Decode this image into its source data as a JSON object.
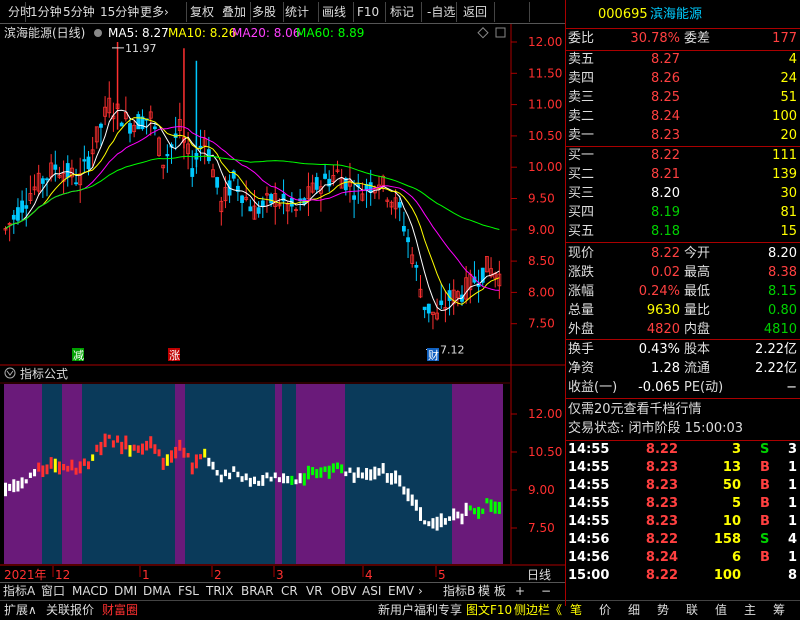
{
  "toolbar": {
    "items": [
      "分时",
      "1分钟",
      "5分钟",
      "15分钟",
      "更多›",
      "复权",
      "叠加",
      "多股",
      "统计",
      "画线",
      "F10",
      "标记",
      "-自选",
      "返回"
    ]
  },
  "chart": {
    "title": "滨海能源(日线)",
    "ma5": "MA5: 8.27",
    "ma10": "MA10: 8.26",
    "ma20": "MA20: 8.06",
    "ma60": "MA60: 8.89",
    "high_label": "11.97",
    "low_label": "7.12",
    "yticks": [
      "12.00",
      "11.50",
      "11.00",
      "10.50",
      "10.00",
      "9.50",
      "9.00",
      "8.50",
      "8.00",
      "7.50"
    ],
    "markers": {
      "jian": "减",
      "zhang": "涨",
      "cai": "财"
    },
    "colors": {
      "up": "#ff3030",
      "down": "#00c8ff",
      "ma5": "#ffffff",
      "ma10": "#ffff00",
      "ma20": "#ff00ff",
      "ma60": "#00ff00"
    }
  },
  "indicator": {
    "title": "指标公式",
    "yticks": [
      "12.00",
      "10.50",
      "9.00",
      "7.50"
    ],
    "colors": {
      "purple": "#6a1a7a",
      "blue": "#0a3a5a"
    }
  },
  "xaxis": {
    "year": "2021年",
    "labels": [
      "12",
      "1",
      "2",
      "3",
      "4",
      "5"
    ],
    "right_label": "日线"
  },
  "tabs": [
    "指标A",
    "窗口",
    "MACD",
    "DMI",
    "DMA",
    "FSL",
    "TRIX",
    "BRAR",
    "CR",
    "VR",
    "OBV",
    "ASI",
    "EMV",
    "›",
    "指标B",
    "模 板",
    "+",
    "−"
  ],
  "statusbar": {
    "left": [
      "扩展∧",
      "关联报价",
      "财富圈"
    ],
    "news": "新用户福利专享",
    "f10": "图文F10",
    "side": "侧边栏《",
    "icons": [
      "笔",
      "价",
      "细",
      "势",
      "联",
      "值",
      "主",
      "筹"
    ]
  },
  "quote": {
    "code": "000695",
    "name": "滨海能源",
    "weibi_label": "委比",
    "weibi": "30.78%",
    "weicha_label": "委差",
    "weicha": "177",
    "asks": [
      {
        "label": "卖五",
        "price": "8.27",
        "vol": "4"
      },
      {
        "label": "卖四",
        "price": "8.26",
        "vol": "24"
      },
      {
        "label": "卖三",
        "price": "8.25",
        "vol": "51"
      },
      {
        "label": "卖二",
        "price": "8.24",
        "vol": "100"
      },
      {
        "label": "卖一",
        "price": "8.23",
        "vol": "20"
      }
    ],
    "bids": [
      {
        "label": "买一",
        "price": "8.22",
        "vol": "111"
      },
      {
        "label": "买二",
        "price": "8.21",
        "vol": "139"
      },
      {
        "label": "买三",
        "price": "8.20",
        "vol": "30"
      },
      {
        "label": "买四",
        "price": "8.19",
        "vol": "81"
      },
      {
        "label": "买五",
        "price": "8.18",
        "vol": "15"
      }
    ],
    "stats": [
      {
        "l1": "现价",
        "v1": "8.22",
        "l2": "今开",
        "v2": "8.20"
      },
      {
        "l1": "涨跌",
        "v1": "0.02",
        "l2": "最高",
        "v2": "8.38"
      },
      {
        "l1": "涨幅",
        "v1": "0.24%",
        "l2": "最低",
        "v2": "8.15"
      },
      {
        "l1": "总量",
        "v1": "9630",
        "l2": "量比",
        "v2": "0.80"
      },
      {
        "l1": "外盘",
        "v1": "4820",
        "l2": "内盘",
        "v2": "4810"
      }
    ],
    "stats2": [
      {
        "l1": "换手",
        "v1": "0.43%",
        "l2": "股本",
        "v2": "2.22亿"
      },
      {
        "l1": "净资",
        "v1": "1.28",
        "l2": "流通",
        "v2": "2.22亿"
      },
      {
        "l1": "收益(一)",
        "v1": "-0.065",
        "l2": "PE(动)",
        "v2": "−"
      }
    ],
    "promo": "仅需20元查看千档行情",
    "trade_status": "交易状态: 闭市阶段 15:00:03",
    "ticks": [
      {
        "t": "14:55",
        "p": "8.22",
        "v": "3",
        "s": "S",
        "n": "3"
      },
      {
        "t": "14:55",
        "p": "8.23",
        "v": "13",
        "s": "B",
        "n": "1"
      },
      {
        "t": "14:55",
        "p": "8.23",
        "v": "50",
        "s": "B",
        "n": "1"
      },
      {
        "t": "14:55",
        "p": "8.23",
        "v": "5",
        "s": "B",
        "n": "1"
      },
      {
        "t": "14:55",
        "p": "8.23",
        "v": "10",
        "s": "B",
        "n": "1"
      },
      {
        "t": "14:56",
        "p": "8.22",
        "v": "158",
        "s": "S",
        "n": "4"
      },
      {
        "t": "14:56",
        "p": "8.24",
        "v": "6",
        "s": "B",
        "n": "1"
      },
      {
        "t": "15:00",
        "p": "8.22",
        "v": "100",
        "s": "",
        "n": "8"
      }
    ]
  }
}
